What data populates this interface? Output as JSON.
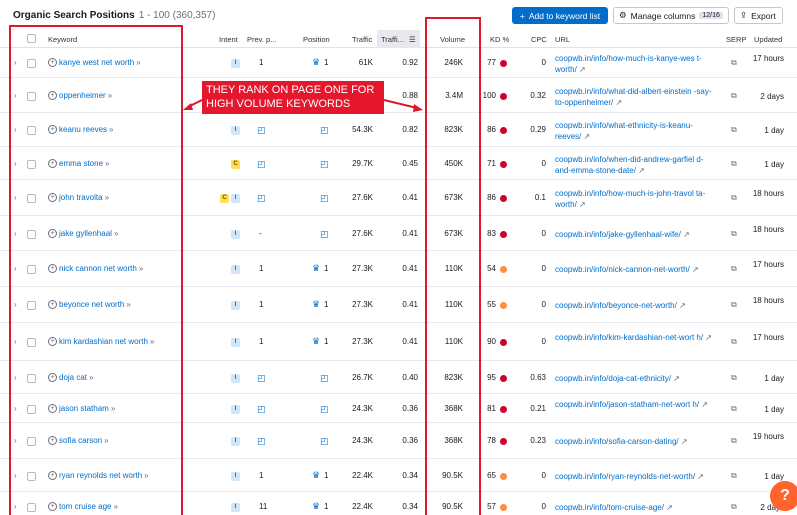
{
  "header": {
    "title": "Organic Search Positions",
    "range": "1 - 100 (360,357)",
    "add_button": "Add to keyword list",
    "manage_button": "Manage columns",
    "manage_count": "12/16",
    "export_button": "Export"
  },
  "columns": {
    "keyword": "Keyword",
    "intent": "Intent",
    "prev_pos": "Prev. p...",
    "position": "Position",
    "traffic": "Traffic",
    "traffic_pct": "Traffi...",
    "volume": "Volume",
    "kd": "KD %",
    "cpc": "CPC",
    "url": "URL",
    "serp": "SERP",
    "updated": "Updated"
  },
  "callout": "THEY RANK ON PAGE ONE FOR HIGH VOLUME KEYWORDS",
  "help_label": "?",
  "colors": {
    "kd_red": "#d1002f",
    "kd_orange": "#ff8c43",
    "accent": "#006dca",
    "annotation": "#e0182d"
  },
  "rows": [
    {
      "keyword": "kanye west net worth",
      "intent": [
        "I"
      ],
      "prev": "1",
      "pos": "1",
      "pos_icon": true,
      "traffic": "61K",
      "traffic_pct": "0.92",
      "volume": "246K",
      "kd": "77",
      "kd_color": "#d1002f",
      "cpc": "0",
      "url": "coopwb.in/info/how-much-is-kanye-wes t-worth/",
      "updated": "17 hours"
    },
    {
      "keyword": "oppenheimer",
      "intent": [],
      "prev": "",
      "pos": "",
      "pos_icon": false,
      "traffic": "",
      "traffic_pct": "0.88",
      "volume": "3.4M",
      "kd": "100",
      "kd_color": "#d1002f",
      "cpc": "0.32",
      "url": "coopwb.in/info/what-did-albert-einstein -say-to-oppenheimer/",
      "updated": "2 days"
    },
    {
      "keyword": "keanu reeves",
      "intent": [
        "I"
      ],
      "prev": "serp",
      "pos": "serp",
      "pos_icon": false,
      "traffic": "54.3K",
      "traffic_pct": "0.82",
      "volume": "823K",
      "kd": "86",
      "kd_color": "#d1002f",
      "cpc": "0.29",
      "url": "coopwb.in/info/what-ethnicity-is-keanu- reeves/",
      "updated": "1 day"
    },
    {
      "keyword": "emma stone",
      "intent": [
        "C"
      ],
      "prev": "serp",
      "pos": "serp",
      "pos_icon": false,
      "traffic": "29.7K",
      "traffic_pct": "0.45",
      "volume": "450K",
      "kd": "71",
      "kd_color": "#d1002f",
      "cpc": "0",
      "url": "coopwb.in/info/when-did-andrew-garfiel d-and-emma-stone-date/",
      "updated": "1 day"
    },
    {
      "keyword": "john travolta",
      "intent": [
        "C",
        "I"
      ],
      "prev": "serp",
      "pos": "serp",
      "pos_icon": false,
      "traffic": "27.6K",
      "traffic_pct": "0.41",
      "volume": "673K",
      "kd": "86",
      "kd_color": "#d1002f",
      "cpc": "0.1",
      "url": "coopwb.in/info/how-much-is-john-travol ta-worth/",
      "updated": "18 hours"
    },
    {
      "keyword": "jake gyllenhaal",
      "intent": [
        "I"
      ],
      "prev": "-",
      "pos": "serp",
      "pos_icon": false,
      "traffic": "27.6K",
      "traffic_pct": "0.41",
      "volume": "673K",
      "kd": "83",
      "kd_color": "#d1002f",
      "cpc": "0",
      "url": "coopwb.in/info/jake-gyllenhaal-wife/",
      "updated": "18 hours"
    },
    {
      "keyword": "nick cannon net worth",
      "intent": [
        "I"
      ],
      "prev": "1",
      "pos": "1",
      "pos_icon": true,
      "traffic": "27.3K",
      "traffic_pct": "0.41",
      "volume": "110K",
      "kd": "54",
      "kd_color": "#ff8c43",
      "cpc": "0",
      "url": "coopwb.in/info/nick-cannon-net-worth/",
      "updated": "17 hours"
    },
    {
      "keyword": "beyonce net worth",
      "intent": [
        "I"
      ],
      "prev": "1",
      "pos": "1",
      "pos_icon": true,
      "traffic": "27.3K",
      "traffic_pct": "0.41",
      "volume": "110K",
      "kd": "55",
      "kd_color": "#ff8c43",
      "cpc": "0",
      "url": "coopwb.in/info/beyonce-net-worth/",
      "updated": "18 hours"
    },
    {
      "keyword": "kim kardashian net worth",
      "intent": [
        "I"
      ],
      "prev": "1",
      "pos": "1",
      "pos_icon": true,
      "traffic": "27.3K",
      "traffic_pct": "0.41",
      "volume": "110K",
      "kd": "90",
      "kd_color": "#d1002f",
      "cpc": "0",
      "url": "coopwb.in/info/kim-kardashian-net-wort h/",
      "updated": "17 hours"
    },
    {
      "keyword": "doja cat",
      "intent": [
        "I"
      ],
      "prev": "serp",
      "pos": "serp",
      "pos_icon": false,
      "traffic": "26.7K",
      "traffic_pct": "0.40",
      "volume": "823K",
      "kd": "95",
      "kd_color": "#d1002f",
      "cpc": "0.63",
      "url": "coopwb.in/info/doja-cat-ethnicity/",
      "updated": "1 day"
    },
    {
      "keyword": "jason statham",
      "intent": [
        "I"
      ],
      "prev": "serp",
      "pos": "serp",
      "pos_icon": false,
      "traffic": "24.3K",
      "traffic_pct": "0.36",
      "volume": "368K",
      "kd": "81",
      "kd_color": "#d1002f",
      "cpc": "0.21",
      "url": "coopwb.in/info/jason-statham-net-wort h/",
      "updated": "1 day"
    },
    {
      "keyword": "sofia carson",
      "intent": [
        "I"
      ],
      "prev": "serp",
      "pos": "serp",
      "pos_icon": false,
      "traffic": "24.3K",
      "traffic_pct": "0.36",
      "volume": "368K",
      "kd": "78",
      "kd_color": "#d1002f",
      "cpc": "0.23",
      "url": "coopwb.in/info/sofia-carson-dating/",
      "updated": "19 hours"
    },
    {
      "keyword": "ryan reynolds net worth",
      "intent": [
        "I"
      ],
      "prev": "1",
      "pos": "1",
      "pos_icon": true,
      "traffic": "22.4K",
      "traffic_pct": "0.34",
      "volume": "90.5K",
      "kd": "65",
      "kd_color": "#ff8c43",
      "cpc": "0",
      "url": "coopwb.in/info/ryan-reynolds-net-worth/",
      "updated": "1 day"
    },
    {
      "keyword": "tom cruise age",
      "intent": [
        "I"
      ],
      "prev": "11",
      "pos": "1",
      "pos_icon": true,
      "traffic": "22.4K",
      "traffic_pct": "0.34",
      "volume": "90.5K",
      "kd": "57",
      "kd_color": "#ff8c43",
      "cpc": "0",
      "url": "coopwb.in/info/tom-cruise-age/",
      "updated": "2 days"
    }
  ]
}
